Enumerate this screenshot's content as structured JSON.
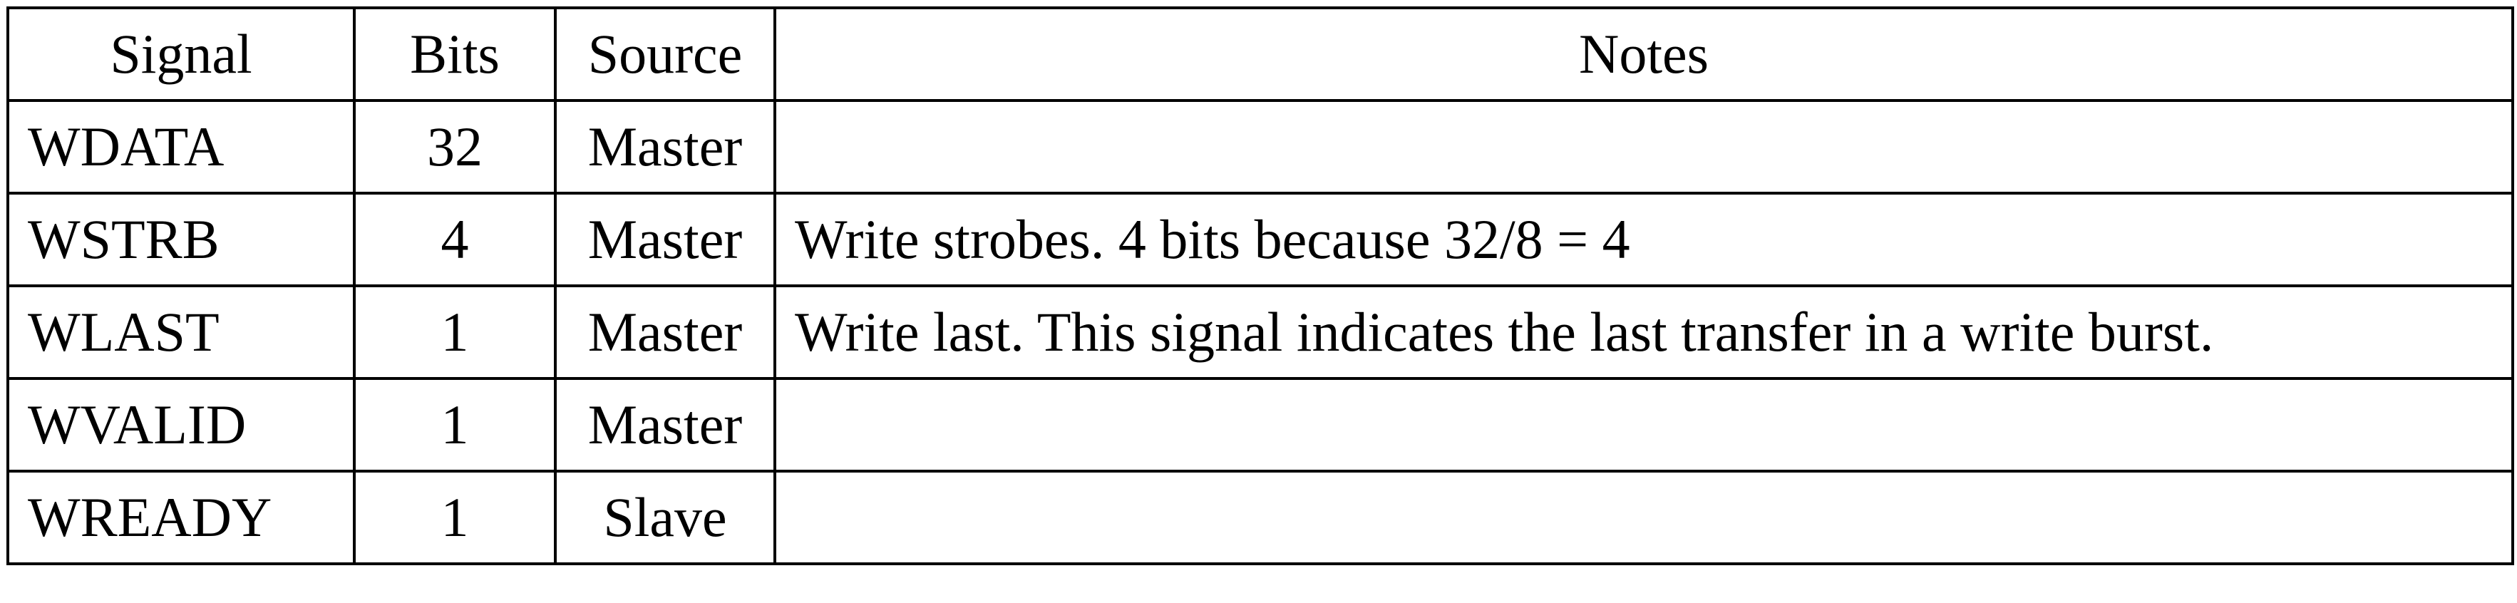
{
  "table": {
    "headers": {
      "signal": "Signal",
      "bits": "Bits",
      "source": "Source",
      "notes": "Notes"
    },
    "rows": [
      {
        "signal": "WDATA",
        "bits": "32",
        "source": "Master",
        "notes": ""
      },
      {
        "signal": "WSTRB",
        "bits": "4",
        "source": "Master",
        "notes": "Write strobes. 4 bits because 32/8 = 4"
      },
      {
        "signal": "WLAST",
        "bits": "1",
        "source": "Master",
        "notes": "Write last. This signal indicates the last transfer in a write burst."
      },
      {
        "signal": "WVALID",
        "bits": "1",
        "source": "Master",
        "notes": ""
      },
      {
        "signal": "WREADY",
        "bits": "1",
        "source": "Slave",
        "notes": ""
      }
    ]
  }
}
